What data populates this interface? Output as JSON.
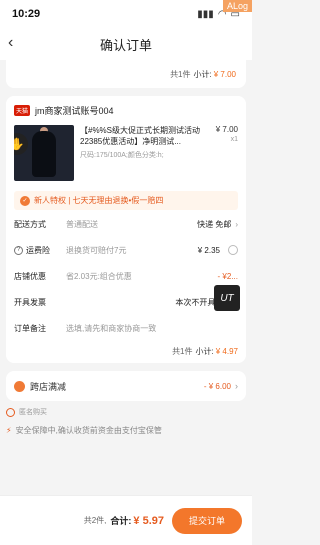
{
  "status": {
    "time": "10:29",
    "badge": "ALog"
  },
  "nav": {
    "title": "确认订单",
    "back": "‹"
  },
  "prev": {
    "count": "共1件",
    "subtotal_label": "小计:",
    "subtotal": "¥ 7.00"
  },
  "shop": {
    "tag": "天猫",
    "name": "jm商家测试账号004",
    "product": {
      "name": "【#%%S级大促正式长期测试活动22385优惠活动】净明测试...",
      "spec": "尺码:175/100A;颜色分类:h;",
      "price": "¥ 7.00",
      "qty": "x1"
    },
    "promo": {
      "text": "新人特权 | 七天无理由退换•假一赔四"
    },
    "rows": [
      {
        "label": "配送方式",
        "hint": "普通配送",
        "value": "快递 免邮"
      },
      {
        "label": "运费险",
        "hint": "退换货可赔付7元",
        "value": "¥ 2.35"
      },
      {
        "label": "店铺优惠",
        "hint": "省2.03元:组合优惠",
        "value": "- ¥2..."
      },
      {
        "label": "开具发票",
        "hint": "",
        "value": "本次不开具发票"
      },
      {
        "label": "订单备注",
        "hint": "选填,请先和商家协商一致",
        "value": ""
      }
    ],
    "total": {
      "count": "共1件",
      "label": "小计:",
      "value": "¥ 4.97"
    }
  },
  "cross": {
    "label": "跨店满减",
    "amount": "- ¥ 6.00"
  },
  "anon": {
    "label": "匿名购买"
  },
  "safe": {
    "text": "安全保障中,确认收货前资金由支付宝保管"
  },
  "bottom": {
    "count": "共2件,",
    "total_label": "合计:",
    "total": "¥ 5.97",
    "submit": "提交订单"
  },
  "overlay": {
    "ut": "UT"
  },
  "colors": {
    "accent": "#f3772b",
    "price": "#e55b1f"
  }
}
